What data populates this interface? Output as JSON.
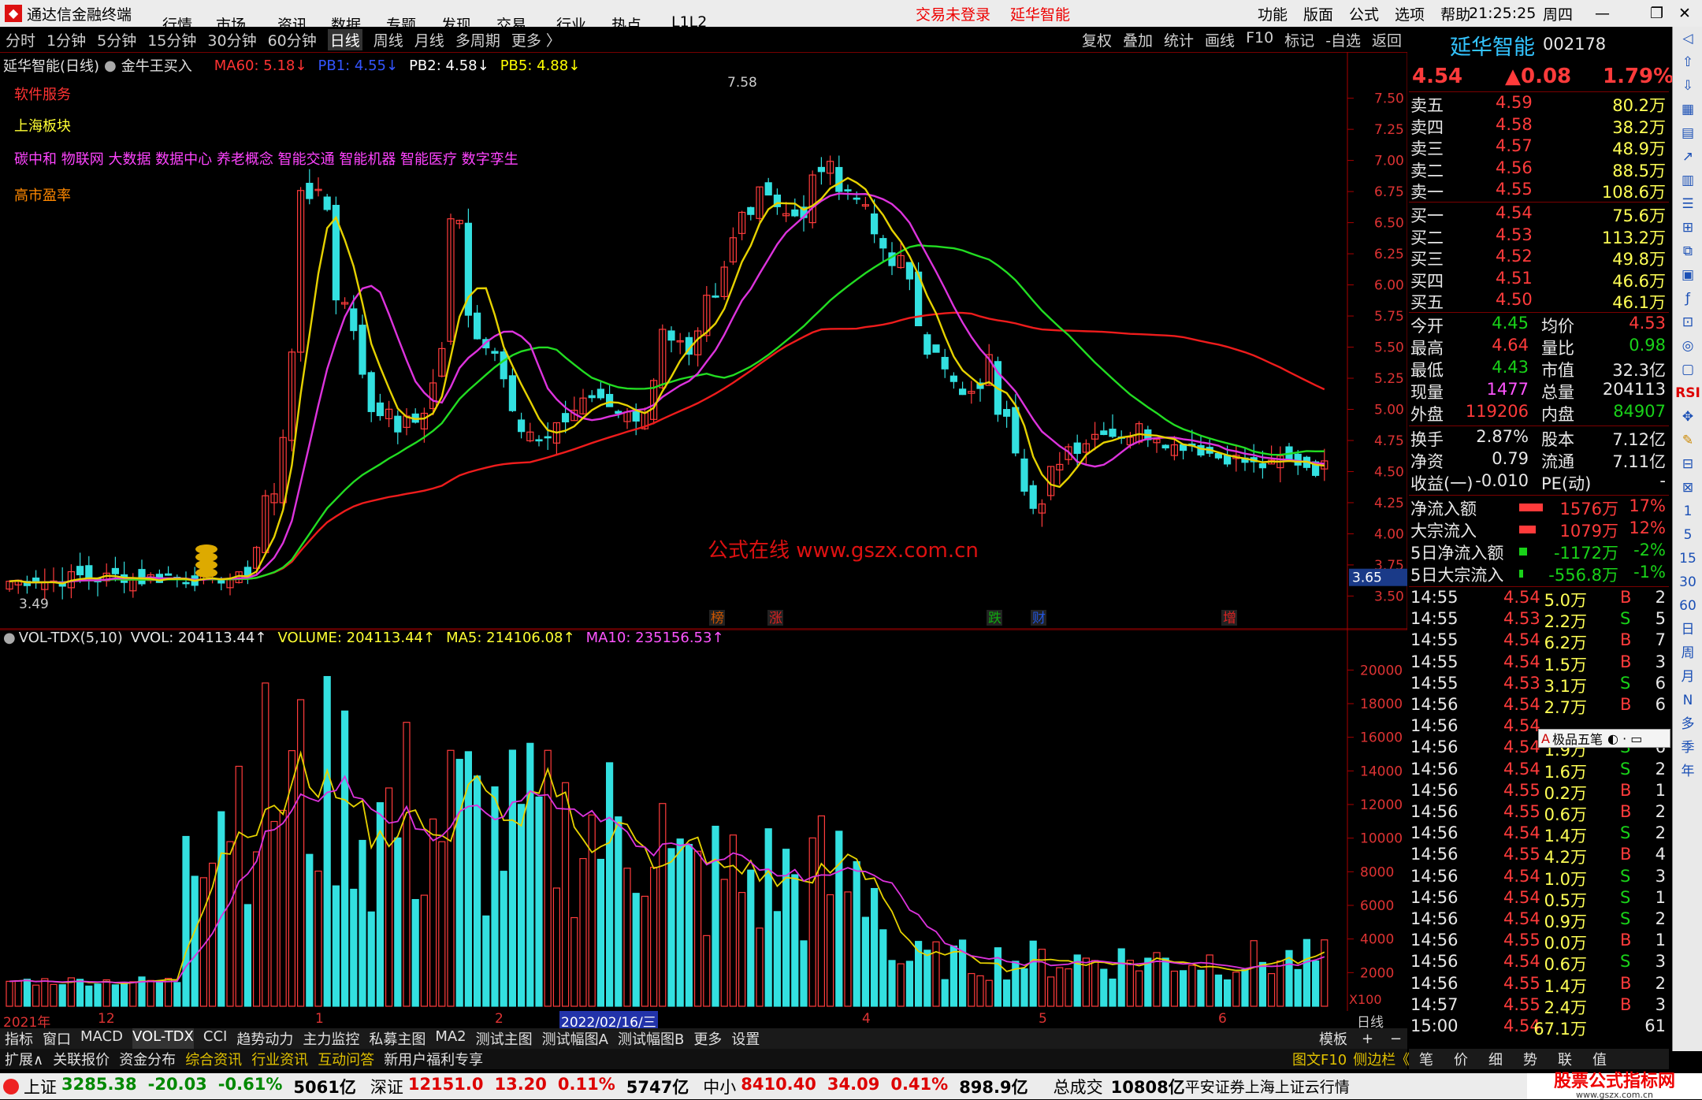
{
  "menubar": {
    "app_title": "通达信金融终端",
    "items": [
      "行情",
      "市场",
      "资讯",
      "数据",
      "专题",
      "发现",
      "交易",
      "行业",
      "热点",
      "L1L2"
    ],
    "login_status": "交易未登录",
    "stock_name": "延华智能",
    "right_items": [
      "功能",
      "版面",
      "公式",
      "选项",
      "帮助"
    ],
    "clock": "21:25:25",
    "weekday": "周四"
  },
  "periodbar": {
    "periods": [
      "分时",
      "1分钟",
      "5分钟",
      "15分钟",
      "30分钟",
      "60分钟",
      "日线",
      "周线",
      "月线",
      "多周期",
      "更多 〉"
    ],
    "active": "日线",
    "tools": [
      "复权",
      "叠加",
      "统计",
      "画线",
      "F10",
      "标记",
      "-自选",
      "返回"
    ]
  },
  "main_chart": {
    "title": "延华智能(日线)",
    "indicator_name": "金牛王买入",
    "legend": [
      {
        "label": "MA60: 5.18↓",
        "color": "#ff3333"
      },
      {
        "label": "PB1: 4.55↓",
        "color": "#3355ff"
      },
      {
        "label": "PB2: 4.58↓",
        "color": "#ffffff"
      },
      {
        "label": "PB5: 4.88↓",
        "color": "#ffff00"
      }
    ],
    "info": {
      "industry": "软件服务",
      "region": "上海板块",
      "concepts": "碳中和 物联网 大数据 数据中心 养老概念 智能交通 智能机器 智能医疗 数字孪生",
      "pe": "高市盈率"
    },
    "high_label": "7.58",
    "low_label": "3.49",
    "price_cursor": "3.65",
    "watermark": "公式在线  www.gszx.com.cn",
    "events": [
      "榜",
      "涨",
      "跌",
      "财",
      "增"
    ],
    "y_ticks": [
      "7.50",
      "7.25",
      "7.00",
      "6.75",
      "6.50",
      "6.25",
      "6.00",
      "5.75",
      "5.50",
      "5.25",
      "5.00",
      "4.75",
      "4.50",
      "4.25",
      "4.00",
      "3.75",
      "3.50"
    ]
  },
  "vol_chart": {
    "title": "VOL-TDX(5,10)",
    "legend": [
      {
        "label": "VVOL: 204113.44↑",
        "color": "#e8e8e8"
      },
      {
        "label": "VOLUME: 204113.44↑",
        "color": "#ffff33"
      },
      {
        "label": "MA5: 214106.08↑",
        "color": "#ffff33"
      },
      {
        "label": "MA10: 235156.53↑",
        "color": "#ff55ff"
      }
    ],
    "y_ticks": [
      "20000",
      "18000",
      "16000",
      "14000",
      "12000",
      "10000",
      "8000",
      "6000",
      "4000",
      "2000"
    ],
    "unit": "X100"
  },
  "date_axis": {
    "labels": [
      "2021年",
      "12",
      "1",
      "2",
      "4",
      "5",
      "6"
    ],
    "cursor_date": "2022/02/16/三",
    "period": "日线"
  },
  "bottom_tabs": {
    "row1": [
      "指标",
      "窗口",
      "MACD",
      "VOL-TDX",
      "CCI",
      "趋势动力",
      "主力监控",
      "私募主图",
      "MA2",
      "测试主图",
      "测试幅图A",
      "测试幅图B",
      "更多",
      "设置"
    ],
    "row1_right": "模板",
    "row2": [
      "扩展∧",
      "关联报价",
      "资金分布",
      "综合资讯",
      "行业资讯",
      "互动问答",
      "新用户福利专享"
    ],
    "row2_right": [
      "图文F10",
      "侧边栏《"
    ]
  },
  "quote": {
    "name": "延华智能",
    "code": "002178",
    "price": "4.54",
    "change": "▲0.08",
    "pct": "1.79%",
    "asks": [
      {
        "label": "卖五",
        "price": "4.59",
        "vol": "80.2万"
      },
      {
        "label": "卖四",
        "price": "4.58",
        "vol": "38.2万"
      },
      {
        "label": "卖三",
        "price": "4.57",
        "vol": "48.9万"
      },
      {
        "label": "卖二",
        "price": "4.56",
        "vol": "88.5万"
      },
      {
        "label": "卖一",
        "price": "4.55",
        "vol": "108.6万"
      }
    ],
    "bids": [
      {
        "label": "买一",
        "price": "4.54",
        "vol": "75.6万"
      },
      {
        "label": "买二",
        "price": "4.53",
        "vol": "113.2万"
      },
      {
        "label": "买三",
        "price": "4.52",
        "vol": "49.8万"
      },
      {
        "label": "买四",
        "price": "4.51",
        "vol": "46.6万"
      },
      {
        "label": "买五",
        "price": "4.50",
        "vol": "46.1万"
      }
    ],
    "stats": [
      {
        "l1": "今开",
        "v1": "4.45",
        "c1": "grn",
        "l2": "均价",
        "v2": "4.53",
        "c2": "red"
      },
      {
        "l1": "最高",
        "v1": "4.64",
        "c1": "red",
        "l2": "量比",
        "v2": "0.98",
        "c2": "grn"
      },
      {
        "l1": "最低",
        "v1": "4.43",
        "c1": "grn",
        "l2": "市值",
        "v2": "32.3亿",
        "c2": "wht"
      },
      {
        "l1": "现量",
        "v1": "1477",
        "c1": "mag",
        "l2": "总量",
        "v2": "204113",
        "c2": "wht"
      },
      {
        "l1": "外盘",
        "v1": "119206",
        "c1": "red",
        "l2": "内盘",
        "v2": "84907",
        "c2": "grn"
      }
    ],
    "stats2": [
      {
        "l1": "换手",
        "v1": "2.87%",
        "l2": "股本",
        "v2": "7.12亿"
      },
      {
        "l1": "净资",
        "v1": "0.79",
        "l2": "流通",
        "v2": "7.11亿"
      },
      {
        "l1": "收益(一)",
        "v1": "-0.010",
        "l2": "PE(动)",
        "v2": "-"
      }
    ],
    "flows": [
      {
        "label": "净流入额",
        "value": "1576万",
        "pct": "17%",
        "color": "red",
        "bar": 0.8
      },
      {
        "label": "大宗流入",
        "value": "1079万",
        "pct": "12%",
        "color": "red",
        "bar": 0.55
      },
      {
        "label": "5日净流入额",
        "value": "-1172万",
        "pct": "-2%",
        "color": "grn",
        "bar": 0.25
      },
      {
        "label": "5日大宗流入",
        "value": "-556.8万",
        "pct": "-1%",
        "color": "grn",
        "bar": 0.12
      }
    ],
    "ticks": [
      [
        "14:55",
        "4.54",
        "5.0万",
        "B",
        "2"
      ],
      [
        "14:55",
        "4.53",
        "2.2万",
        "S",
        "5"
      ],
      [
        "14:55",
        "4.54",
        "6.2万",
        "B",
        "7"
      ],
      [
        "14:55",
        "4.54",
        "1.5万",
        "B",
        "3"
      ],
      [
        "14:55",
        "4.53",
        "3.1万",
        "S",
        "6"
      ],
      [
        "14:56",
        "4.54",
        "2.7万",
        "B",
        "6"
      ],
      [
        "14:56",
        "4.54",
        "",
        "",
        ""
      ],
      [
        "14:56",
        "4.54",
        "1.9万",
        "S",
        "6"
      ],
      [
        "14:56",
        "4.54",
        "1.6万",
        "S",
        "2"
      ],
      [
        "14:56",
        "4.55",
        "0.2万",
        "B",
        "1"
      ],
      [
        "14:56",
        "4.55",
        "0.6万",
        "B",
        "2"
      ],
      [
        "14:56",
        "4.54",
        "1.4万",
        "S",
        "2"
      ],
      [
        "14:56",
        "4.55",
        "4.2万",
        "B",
        "4"
      ],
      [
        "14:56",
        "4.54",
        "1.0万",
        "S",
        "3"
      ],
      [
        "14:56",
        "4.54",
        "0.5万",
        "S",
        "1"
      ],
      [
        "14:56",
        "4.54",
        "0.9万",
        "S",
        "2"
      ],
      [
        "14:56",
        "4.55",
        "0.0万",
        "B",
        "1"
      ],
      [
        "14:56",
        "4.54",
        "0.6万",
        "S",
        "3"
      ],
      [
        "14:56",
        "4.55",
        "1.4万",
        "B",
        "2"
      ],
      [
        "14:57",
        "4.55",
        "2.4万",
        "B",
        "3"
      ],
      [
        "15:00",
        "4.54",
        "67.1万",
        "",
        "61"
      ]
    ],
    "popup": "极品五笔",
    "bottom_tabs": [
      "笔",
      "价",
      "细",
      "势",
      "联",
      "值"
    ]
  },
  "sidebar": {
    "items": [
      "RSI",
      "1",
      "5",
      "15",
      "30",
      "60",
      "日",
      "周",
      "月",
      "N",
      "多",
      "季",
      "年"
    ]
  },
  "ticker": {
    "items": [
      {
        "name": "上证",
        "value": "3285.38",
        "chg": "-20.03",
        "pct": "-0.61%",
        "amt": "5061亿",
        "dir": "grn"
      },
      {
        "name": "深证",
        "value": "12151.0",
        "chg": "13.20",
        "pct": "0.11%",
        "amt": "5747亿",
        "dir": "red"
      },
      {
        "name": "中小",
        "value": "8410.40",
        "chg": "34.09",
        "pct": "0.41%",
        "amt": "898.9亿",
        "dir": "red"
      }
    ],
    "total_label": "总成交",
    "total_value": "10808亿",
    "source": "平安证券上海上证云行情",
    "brand": "股票公式指标网",
    "brand_url": "www.gszx.com.cn"
  },
  "colors": {
    "up": "#ff3b3b",
    "down": "#33e0e0",
    "ma_green": "#22dd22",
    "ma_red": "#ee1c1c",
    "ma_yellow": "#e6d200",
    "ma_magenta": "#dd33dd"
  }
}
